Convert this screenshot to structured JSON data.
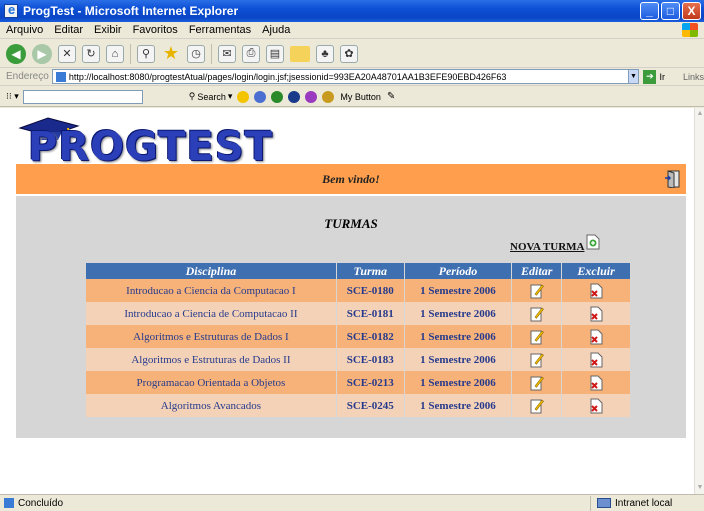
{
  "window": {
    "title": "ProgTest - Microsoft Internet Explorer",
    "controls": {
      "minimize": "_",
      "maximize": "□",
      "close": "X"
    }
  },
  "menu": [
    "Arquivo",
    "Editar",
    "Exibir",
    "Favoritos",
    "Ferramentas",
    "Ajuda"
  ],
  "address": {
    "label": "Endereço",
    "url": "http://localhost:8080/progtestAtual/pages/login/login.jsf;jsessionid=993EA20A48701AA1B3EFE90EBD426F63",
    "go_label": "Ir",
    "links_label": "Links"
  },
  "searchbar": {
    "search_label": "Search",
    "my_button_label": "My Button"
  },
  "page": {
    "logo_text": "PROGTEST",
    "welcome": "Bem vindo!",
    "section_title": "TURMAS",
    "new_class_link": "NOVA TURMA",
    "table": {
      "headers": [
        "Disciplina",
        "Turma",
        "Período",
        "Editar",
        "Excluir"
      ],
      "rows": [
        {
          "disciplina": "Introducao a Ciencia da Computacao I",
          "turma": "SCE-0180",
          "periodo": "1 Semestre 2006"
        },
        {
          "disciplina": "Introducao a Ciencia de Computacao II",
          "turma": "SCE-0181",
          "periodo": "1 Semestre 2006"
        },
        {
          "disciplina": "Algoritmos e Estruturas de Dados I",
          "turma": "SCE-0182",
          "periodo": "1 Semestre 2006"
        },
        {
          "disciplina": "Algoritmos e Estruturas de Dados II",
          "turma": "SCE-0183",
          "periodo": "1 Semestre 2006"
        },
        {
          "disciplina": "Programacao Orientada a Objetos",
          "turma": "SCE-0213",
          "periodo": "1 Semestre 2006"
        },
        {
          "disciplina": "Algoritmos Avancados",
          "turma": "SCE-0245",
          "periodo": "1 Semestre 2006"
        }
      ]
    }
  },
  "status": {
    "left": "Concluído",
    "zone": "Intranet local"
  },
  "colors": {
    "header_bg": "#3e6fb0",
    "row_odd": "#f7b27a",
    "row_even": "#f4d2b8",
    "welcome_bar": "#ff9f4d",
    "panel_bg": "#d6d6d6",
    "link_text": "#253a8c"
  }
}
